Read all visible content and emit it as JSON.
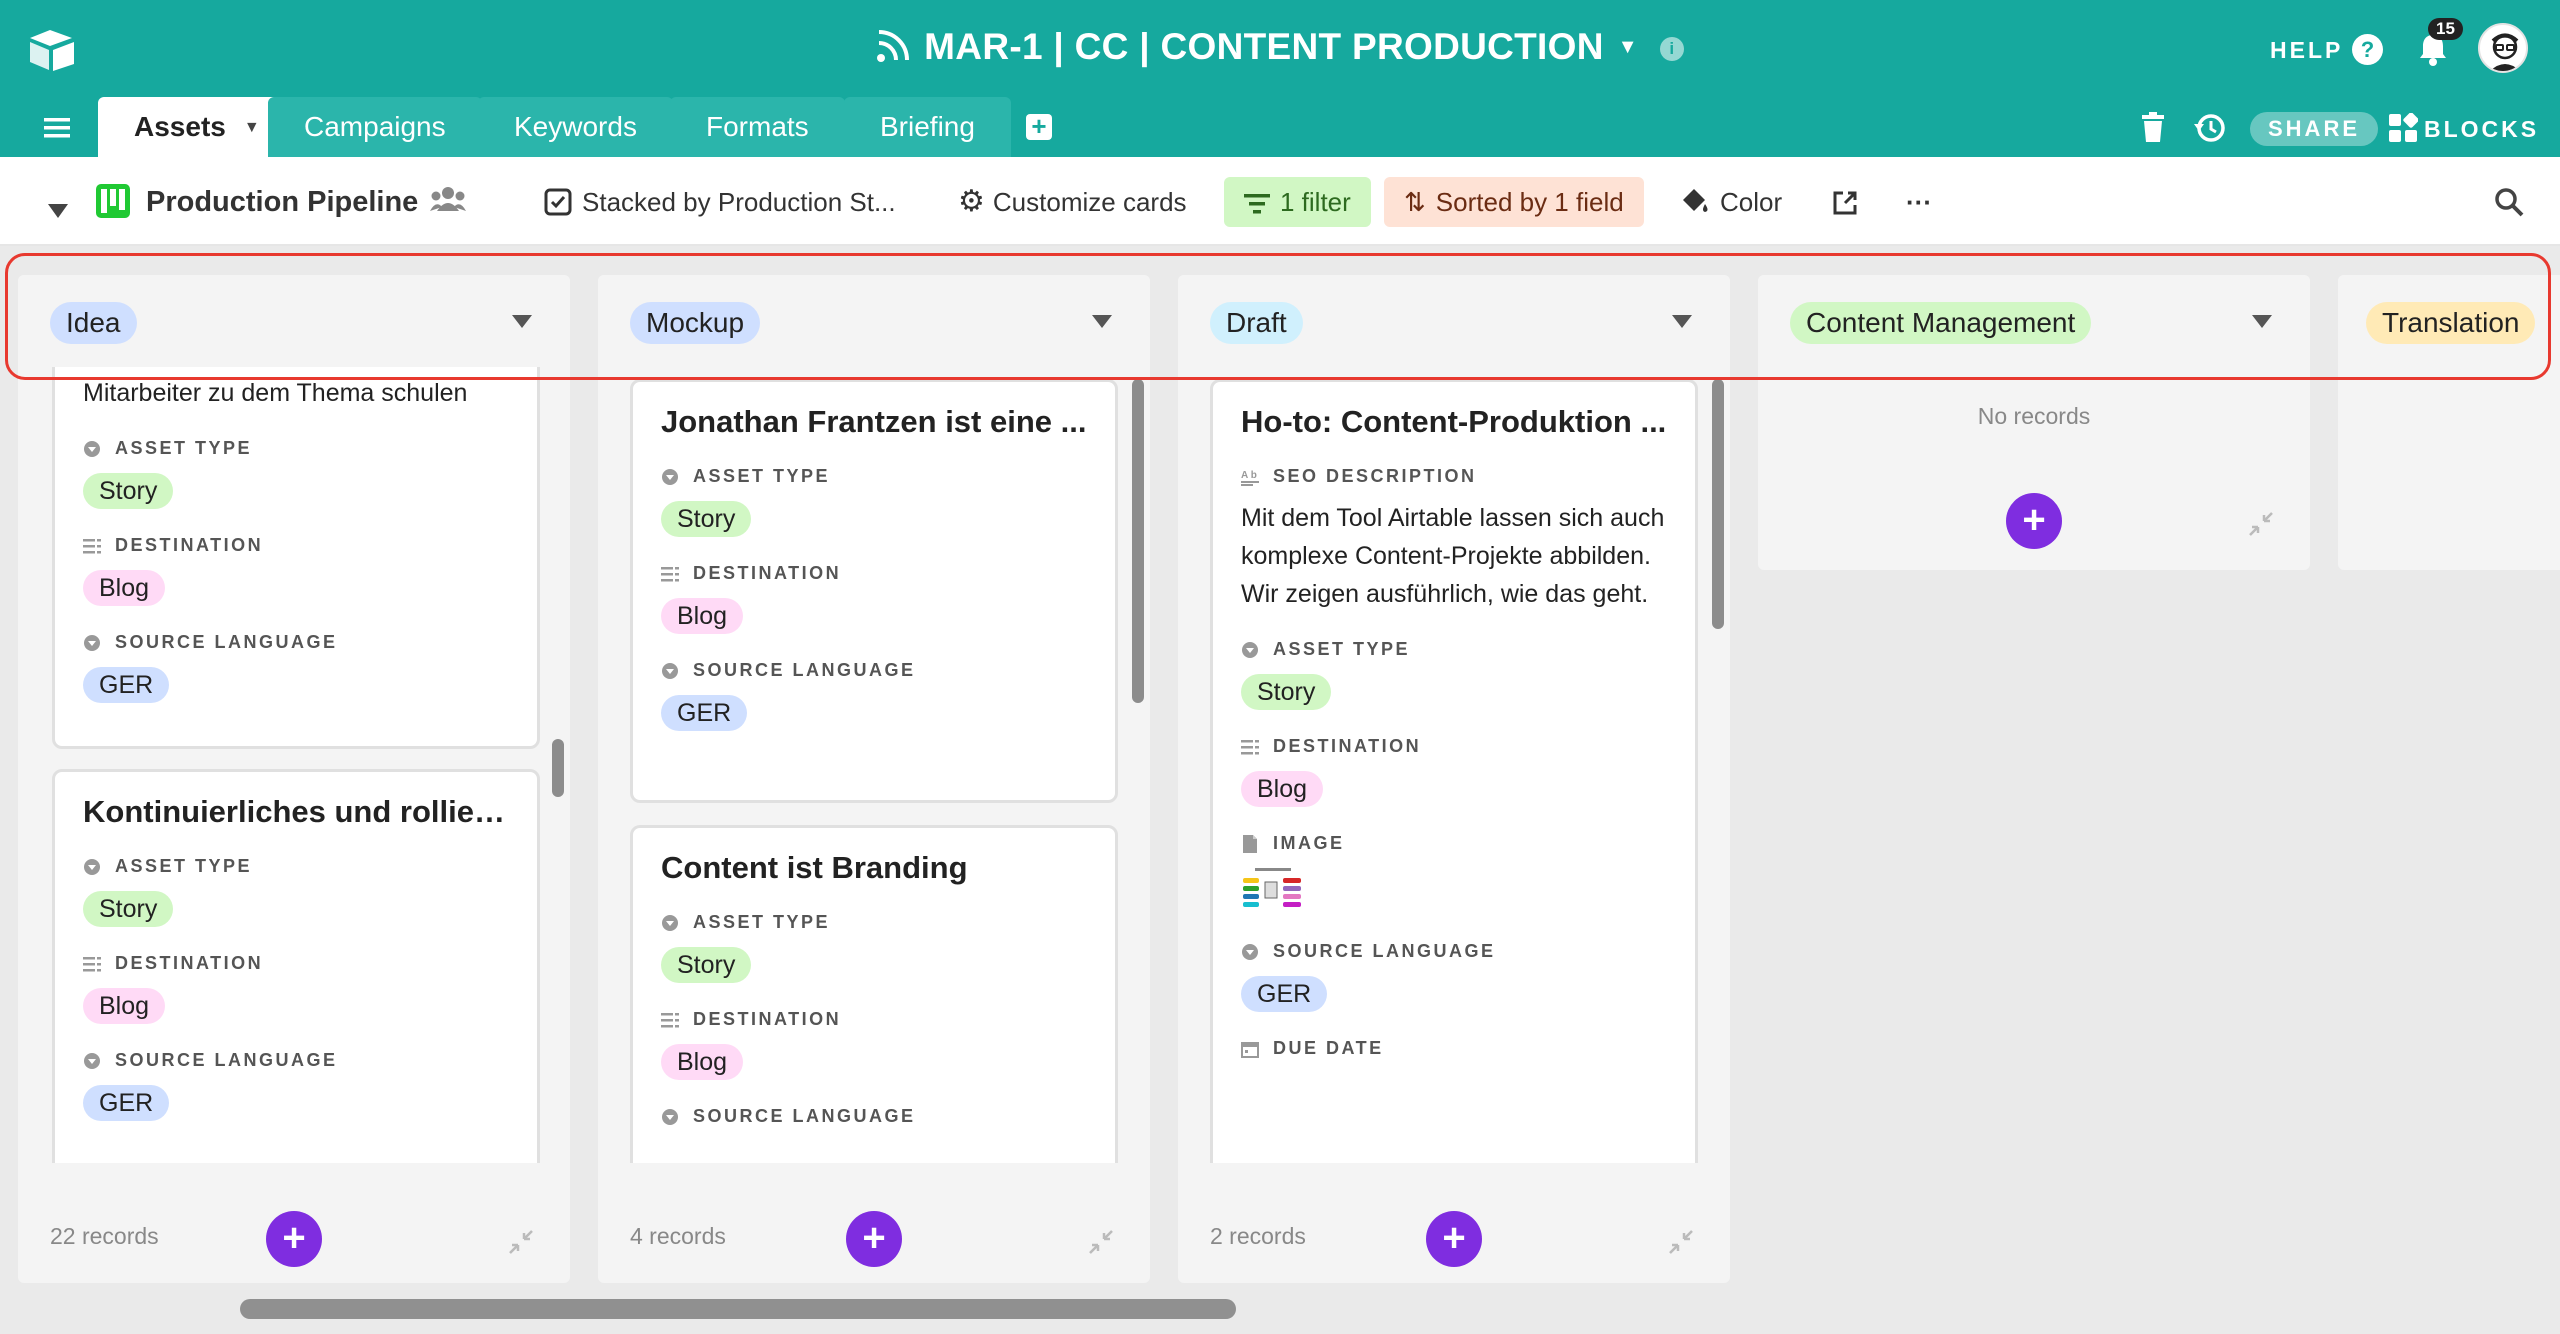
{
  "app": {
    "base_title": "MAR-1 | CC | CONTENT PRODUCTION",
    "help_label": "HELP",
    "notification_count": "15",
    "share_label": "SHARE",
    "blocks_label": "BLOCKS"
  },
  "tabs": [
    {
      "label": "Assets",
      "active": true
    },
    {
      "label": "Campaigns",
      "active": false
    },
    {
      "label": "Keywords",
      "active": false
    },
    {
      "label": "Formats",
      "active": false
    },
    {
      "label": "Briefing",
      "active": false
    }
  ],
  "toolbar": {
    "view_name": "Production Pipeline",
    "stacked_by": "Stacked by Production St...",
    "customize": "Customize cards",
    "filter": "1 filter",
    "sort": "Sorted by 1 field",
    "color": "Color",
    "more": "···"
  },
  "colors": {
    "teal": "#16a99e",
    "add_button": "#7f2de0",
    "story_tag": "#d1f7c4",
    "blog_tag": "#ffdaf6",
    "ger_tag": "#cfdfff",
    "highlight": "#e8392f"
  },
  "columns": [
    {
      "name": "Idea",
      "pill_color": "#cfdfff",
      "records": "22 records",
      "cards": [
        {
          "partial_text": "Mitarbeiter zu dem Thema schulen",
          "asset_type_label": "ASSET TYPE",
          "asset_type": "Story",
          "destination_label": "DESTINATION",
          "destination": "Blog",
          "source_language_label": "SOURCE LANGUAGE",
          "source_language": "GER"
        },
        {
          "title": "Kontinuierliches und rolliere...",
          "asset_type_label": "ASSET TYPE",
          "asset_type": "Story",
          "destination_label": "DESTINATION",
          "destination": "Blog",
          "source_language_label": "SOURCE LANGUAGE",
          "source_language": "GER"
        }
      ]
    },
    {
      "name": "Mockup",
      "pill_color": "#cfdfff",
      "records": "4 records",
      "cards": [
        {
          "title": "Jonathan Frantzen ist eine ...",
          "asset_type_label": "ASSET TYPE",
          "asset_type": "Story",
          "destination_label": "DESTINATION",
          "destination": "Blog",
          "source_language_label": "SOURCE LANGUAGE",
          "source_language": "GER"
        },
        {
          "title": "Content ist Branding",
          "asset_type_label": "ASSET TYPE",
          "asset_type": "Story",
          "destination_label": "DESTINATION",
          "destination": "Blog",
          "source_language_label": "SOURCE LANGUAGE"
        }
      ]
    },
    {
      "name": "Draft",
      "pill_color": "#d0f0fd",
      "records": "2 records",
      "cards": [
        {
          "title": "Ho-to: Content-Produktion ...",
          "seo_label": "SEO DESCRIPTION",
          "seo_description": "Mit dem Tool Airtable lassen sich auch komplexe Content-Projekte abbilden. Wir zeigen ausführlich, wie das geht.",
          "asset_type_label": "ASSET TYPE",
          "asset_type": "Story",
          "destination_label": "DESTINATION",
          "destination": "Blog",
          "image_label": "IMAGE",
          "source_language_label": "SOURCE LANGUAGE",
          "source_language": "GER",
          "due_date_label": "DUE DATE"
        }
      ]
    },
    {
      "name": "Content Management",
      "pill_color": "#d1f7c4",
      "empty_text": "No records"
    },
    {
      "name": "Translation",
      "pill_color": "#ffeab6"
    }
  ]
}
